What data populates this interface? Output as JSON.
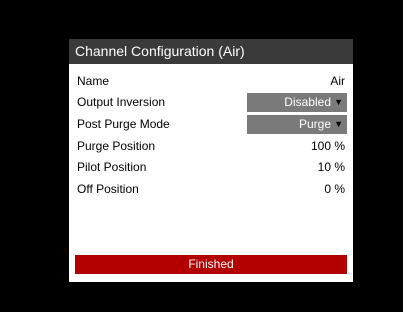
{
  "dialog": {
    "title": "Channel Configuration  (Air)",
    "rows": [
      {
        "label": "Name",
        "value": "Air"
      },
      {
        "label": "Output Inversion",
        "value": "Disabled"
      },
      {
        "label": "Post Purge Mode",
        "value": "Purge"
      },
      {
        "label": "Purge Position",
        "value": "100 %"
      },
      {
        "label": "Pilot Position",
        "value": "10 %"
      },
      {
        "label": "Off Position",
        "value": "0 %"
      }
    ],
    "dropdown_caret": "▼",
    "finished_label": "Finished"
  },
  "colors": {
    "background": "#000000",
    "title_bar": "#3a3a3a",
    "dropdown": "#7a7a7a",
    "finished_button": "#b30000"
  }
}
